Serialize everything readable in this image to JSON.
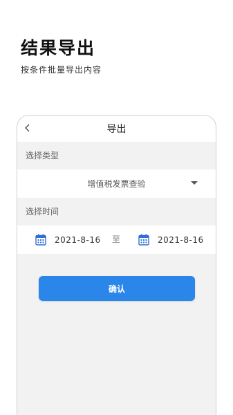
{
  "promo": {
    "title": "结果导出",
    "subtitle": "按条件批量导出内容"
  },
  "screen": {
    "nav": {
      "back_icon": "chevron-left-icon",
      "title": "导出"
    },
    "type_section": {
      "label": "选择类型",
      "selected_value": "增值税发票查验",
      "dropdown_icon": "caret-down-icon"
    },
    "time_section": {
      "label": "选择时间",
      "start_date": "2021-8-16",
      "separator": "至",
      "end_date": "2021-8-16",
      "calendar_icon": "calendar-icon"
    },
    "confirm_label": "确认"
  },
  "colors": {
    "accent": "#2b86ea",
    "background": "#f2f2f2",
    "calendar_icon": "#2f6fd6"
  }
}
